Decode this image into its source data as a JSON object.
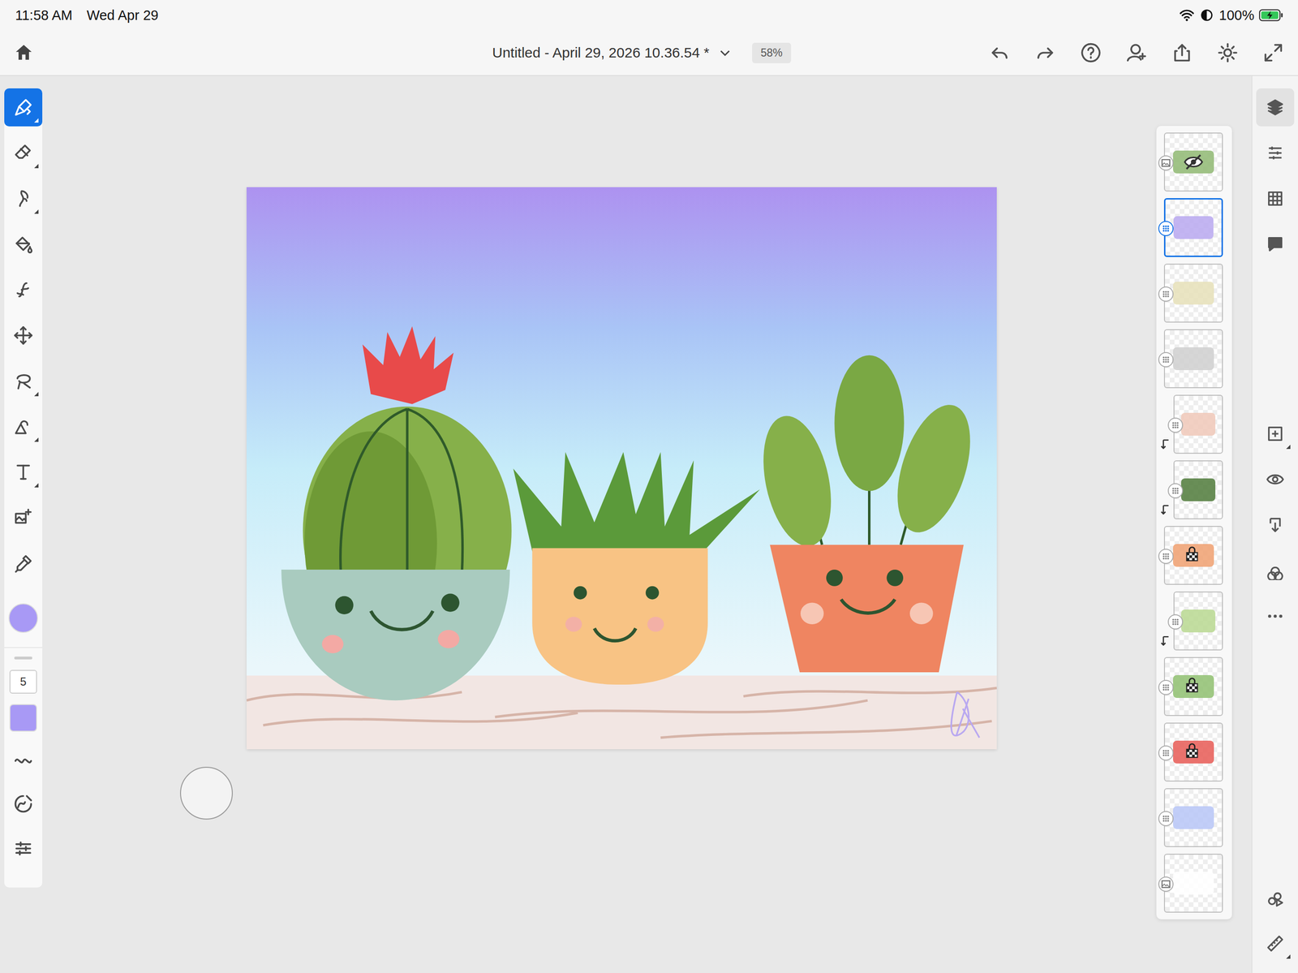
{
  "status_bar": {
    "time": "11:58 AM",
    "date": "Wed Apr 29",
    "battery": "100%",
    "charging": true
  },
  "document": {
    "title": "Untitled - April 29, 2026 10.36.54 *",
    "zoom": "58%"
  },
  "toolbar": {
    "tools": [
      {
        "selected": true,
        "has_options": true
      },
      {
        "selected": false,
        "has_options": true
      },
      {
        "selected": false,
        "has_options": true
      },
      {
        "selected": false,
        "has_options": false
      },
      {
        "selected": false,
        "has_options": false
      },
      {
        "selected": false,
        "has_options": false
      },
      {
        "selected": false,
        "has_options": true
      },
      {
        "selected": false,
        "has_options": true
      },
      {
        "selected": false,
        "has_options": true
      },
      {
        "selected": false,
        "has_options": false
      },
      {
        "selected": false,
        "has_options": false
      }
    ],
    "brush": {
      "size": "5",
      "color": "#a899f5"
    }
  },
  "layers": [
    {
      "kind": "image",
      "selected": false,
      "hidden": true,
      "clipped": false,
      "alpha_locked": false,
      "color": "#8fb872"
    },
    {
      "kind": "pixel",
      "selected": true,
      "hidden": false,
      "clipped": false,
      "alpha_locked": false,
      "color": "#b9a8f0"
    },
    {
      "kind": "pixel",
      "selected": false,
      "hidden": false,
      "clipped": false,
      "alpha_locked": false,
      "color": "#e6e0b8"
    },
    {
      "kind": "pixel",
      "selected": false,
      "hidden": false,
      "clipped": false,
      "alpha_locked": false,
      "color": "#cfcfcf"
    },
    {
      "kind": "pixel",
      "selected": false,
      "hidden": false,
      "clipped": true,
      "alpha_locked": false,
      "color": "#f0c8b8"
    },
    {
      "kind": "pixel",
      "selected": false,
      "hidden": false,
      "clipped": true,
      "alpha_locked": false,
      "color": "#4f7a3a"
    },
    {
      "kind": "pixel",
      "selected": false,
      "hidden": false,
      "clipped": false,
      "alpha_locked": true,
      "color": "#f0a070"
    },
    {
      "kind": "pixel",
      "selected": false,
      "hidden": false,
      "clipped": true,
      "alpha_locked": false,
      "color": "#b8d890"
    },
    {
      "kind": "pixel",
      "selected": false,
      "hidden": false,
      "clipped": false,
      "alpha_locked": true,
      "color": "#8fc070"
    },
    {
      "kind": "pixel",
      "selected": false,
      "hidden": false,
      "clipped": false,
      "alpha_locked": true,
      "color": "#e85a55"
    },
    {
      "kind": "pixel",
      "selected": false,
      "hidden": false,
      "clipped": false,
      "alpha_locked": false,
      "color": "#b7c6f7"
    },
    {
      "kind": "image",
      "selected": false,
      "hidden": false,
      "clipped": false,
      "alpha_locked": false,
      "color": "#ffffff"
    }
  ],
  "rail": {
    "panels": [
      {
        "selected": true
      },
      {
        "selected": false
      },
      {
        "selected": false
      },
      {
        "selected": false
      }
    ],
    "actions": [
      {
        "has_options": true
      },
      {
        "has_options": false
      },
      {
        "has_options": false
      },
      {
        "has_options": false
      },
      {
        "has_options": false
      }
    ],
    "bottom": [
      {
        "has_options": false
      },
      {
        "has_options": true
      }
    ]
  }
}
